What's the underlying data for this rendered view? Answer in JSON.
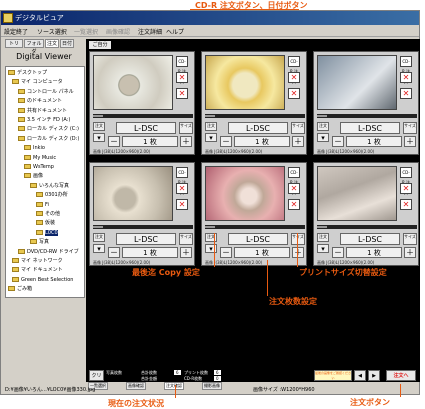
{
  "window": {
    "title": "デジタルビュア"
  },
  "menu": [
    "設定終了",
    "ソース選択",
    "一覧選択",
    "画像確認",
    "注文詳細",
    "ヘルプ"
  ],
  "left": {
    "tabs": [
      "トリ",
      "フォルダ",
      "注文",
      "日付"
    ],
    "app_title": "Digital Viewer",
    "tree": [
      {
        "label": "デスクトップ",
        "sel": false
      },
      {
        "label": "マイ コンピュータ",
        "sel": false
      },
      {
        "label": "コントロール パネル",
        "sel": false
      },
      {
        "label": "のドキュメント",
        "sel": false
      },
      {
        "label": "共有ドキュメント",
        "sel": false
      },
      {
        "label": "3.5 インチ FD (A:)",
        "sel": false
      },
      {
        "label": "ローカル ディスク (C:)",
        "sel": false
      },
      {
        "label": "ローカル ディスク (D:)",
        "sel": false
      },
      {
        "label": "Inkio",
        "sel": false
      },
      {
        "label": "My Music",
        "sel": false
      },
      {
        "label": "WsTemp",
        "sel": false
      },
      {
        "label": "画像",
        "sel": false
      },
      {
        "label": "いろんな写真",
        "sel": false
      },
      {
        "label": "0301办所",
        "sel": false
      },
      {
        "label": "Fi",
        "sel": false
      },
      {
        "label": "その他",
        "sel": false
      },
      {
        "label": "仮装",
        "sel": false
      },
      {
        "label": "L0C0",
        "sel": true
      },
      {
        "label": "写真",
        "sel": false
      },
      {
        "label": "DVD/CD-RW ドライブ",
        "sel": false
      },
      {
        "label": "マイ ネットワーク",
        "sel": false
      },
      {
        "label": "マイ ドキュメント",
        "sel": false
      },
      {
        "label": "Green Best Selection",
        "sel": false
      },
      {
        "label": "ごみ箱",
        "sel": false
      }
    ]
  },
  "main_tab": "ご自分",
  "panels": [
    {
      "size": "L-DSC",
      "qty": "1 枚",
      "caption": "画像 J(38)L(1200×960)(2.00)"
    },
    {
      "size": "L-DSC",
      "qty": "1 枚",
      "caption": "画像 J(38)L(1200×960)(2.00)"
    },
    {
      "size": "L-DSC",
      "qty": "1 枚",
      "caption": "画像 J(38)L(1200×960)(2.00)"
    },
    {
      "size": "L-DSC",
      "qty": "1 枚",
      "caption": "画像 J(38)L(1200×960)(2.00)"
    },
    {
      "size": "L-DSC",
      "qty": "1 枚",
      "caption": "画像 J(38)L(1200×960)(2.00)"
    },
    {
      "size": "L-DSC",
      "qty": "1 枚",
      "caption": "画像 J(38)L(1200×960)(2.00)"
    }
  ],
  "panel_labels": {
    "order": "注文",
    "order_all": "全文",
    "side": "サイズ",
    "cd": "CD-R 注文",
    "date": "日付"
  },
  "bottom": {
    "clear": "クリア",
    "stats": [
      "写真枚数",
      "合計枚数",
      "合計金額",
      "プリント枚数",
      "CD-R枚数"
    ],
    "values": [
      "6",
      "6",
      "0"
    ],
    "help_text": "最後の画像をご確認ください",
    "order_button": "注文へ",
    "tabs": [
      "一覧選択",
      "画像確認",
      "注文確認",
      "撮影画像"
    ]
  },
  "status": {
    "path": "D:¥画像¥いろん…¥LOC0¥画像330.jpg",
    "image_size": "画像サイズ :W1200*H960"
  },
  "annotations": {
    "cd_order": "CD-R 注文ボタン、日付ボタン",
    "copy": "最後迄 Copy 設定",
    "print_size": "プリントサイズ切替設定",
    "qty": "注文枚数設定",
    "status": "現在の注文状況",
    "order": "注文ボタン"
  },
  "colors": {
    "accent": "#e85a10",
    "title": "#0a246a"
  }
}
